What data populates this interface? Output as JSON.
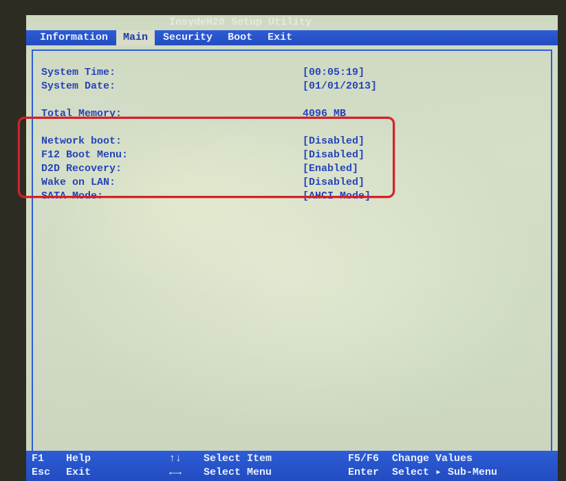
{
  "title": "InsydeH20 Setup Utility",
  "menu": {
    "items": [
      "Information",
      "Main",
      "Security",
      "Boot",
      "Exit"
    ],
    "active_index": 1
  },
  "main": {
    "system_time": {
      "label": "System Time:",
      "value": "[00:05:19]"
    },
    "system_date": {
      "label": "System Date:",
      "value": "[01/01/2013]"
    },
    "total_memory": {
      "label": "Total Memory:",
      "value": "4096 MB"
    },
    "network_boot": {
      "label": "Network boot:",
      "value": "[Disabled]"
    },
    "f12_boot_menu": {
      "label": "F12 Boot Menu:",
      "value": "[Disabled]"
    },
    "d2d_recovery": {
      "label": "D2D Recovery:",
      "value": "[Enabled]"
    },
    "wake_on_lan": {
      "label": "Wake on LAN:",
      "value": "[Disabled]"
    },
    "sata_mode": {
      "label": "SATA Mode:",
      "value": "[AHCI Mode]"
    }
  },
  "footer": {
    "f1": {
      "key": "F1",
      "action": "Help"
    },
    "esc": {
      "key": "Esc",
      "action": "Exit"
    },
    "updown": {
      "key": "↑↓",
      "action": "Select Item"
    },
    "leftright": {
      "key": "←→",
      "action": "Select Menu"
    },
    "f5f6": {
      "key": "F5/F6",
      "action": "Change Values"
    },
    "enter": {
      "key": "Enter",
      "action": "Select ▸ Sub-Menu"
    }
  }
}
